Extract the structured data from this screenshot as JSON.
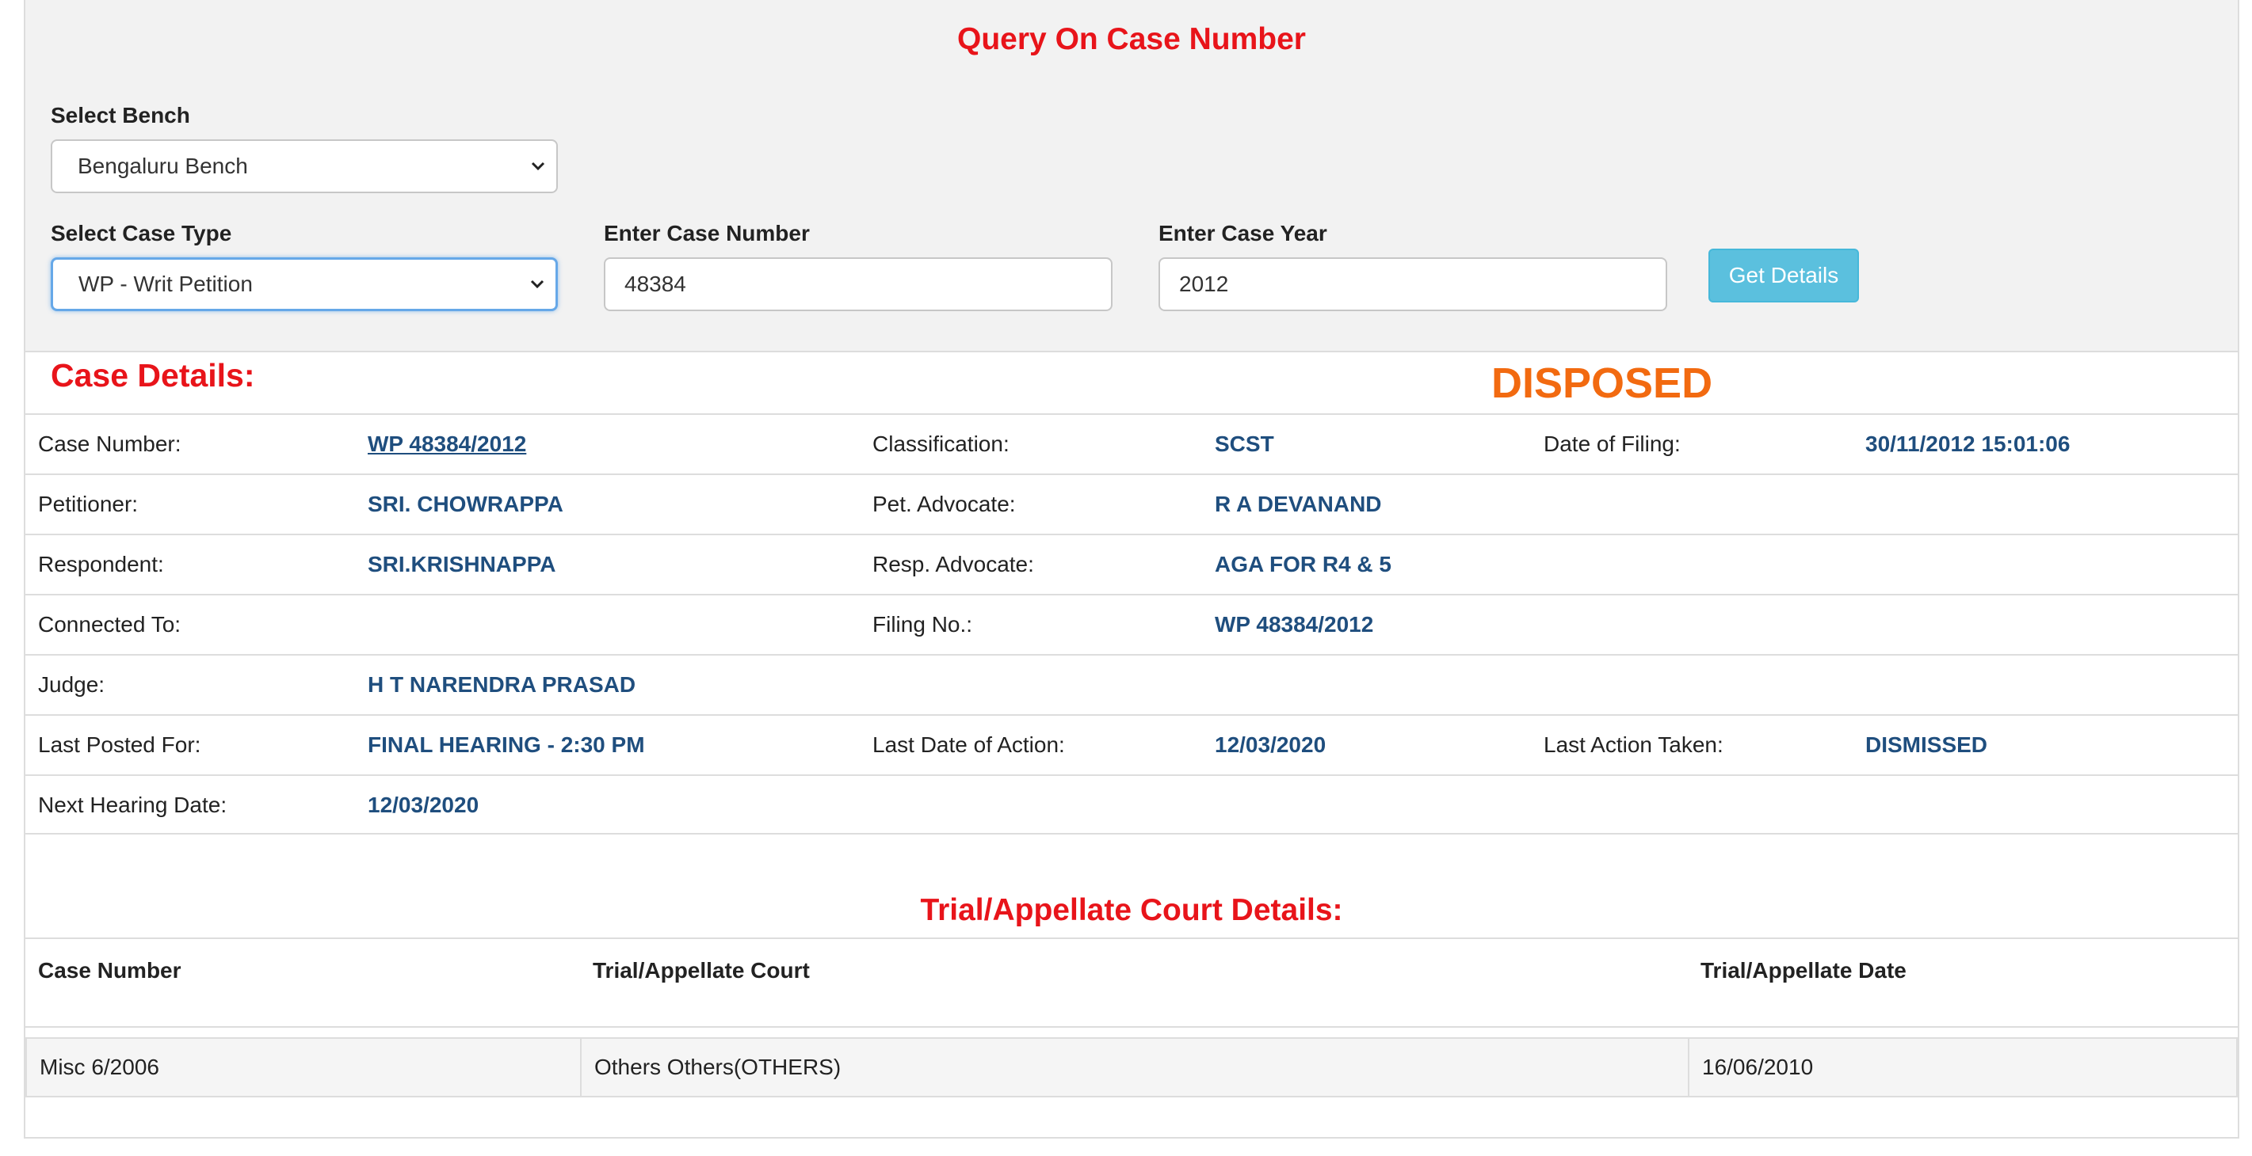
{
  "query": {
    "title": "Query On Case Number",
    "bench_label": "Select Bench",
    "bench_value": "Bengaluru Bench",
    "case_type_label": "Select Case Type",
    "case_type_value": "WP - Writ Petition",
    "case_number_label": "Enter Case Number",
    "case_number_value": "48384",
    "case_year_label": "Enter Case Year",
    "case_year_value": "2012",
    "submit_label": "Get Details"
  },
  "case": {
    "heading": "Case Details:",
    "status": "DISPOSED",
    "case_number_label": "Case Number:",
    "case_number": "WP 48384/2012",
    "classification_label": "Classification:",
    "classification": "SCST",
    "date_of_filing_label": "Date of Filing:",
    "date_of_filing": "30/11/2012 15:01:06",
    "petitioner_label": "Petitioner:",
    "petitioner": "SRI. CHOWRAPPA",
    "pet_advocate_label": "Pet. Advocate:",
    "pet_advocate": "R A DEVANAND",
    "respondent_label": "Respondent:",
    "respondent": "SRI.KRISHNAPPA",
    "resp_advocate_label": "Resp. Advocate:",
    "resp_advocate": "AGA FOR R4 & 5",
    "connected_to_label": "Connected To:",
    "filing_no_label": "Filing No.:",
    "filing_no": "WP 48384/2012",
    "judge_label": "Judge:",
    "judge": "H T NARENDRA PRASAD",
    "last_posted_label": "Last Posted For:",
    "last_posted": "FINAL HEARING - 2:30 PM",
    "last_date_label": "Last Date of Action:",
    "last_date": "12/03/2020",
    "last_action_label": "Last Action Taken:",
    "last_action": "DISMISSED",
    "next_hearing_label": "Next Hearing Date:",
    "next_hearing": "12/03/2020"
  },
  "trial": {
    "heading": "Trial/Appellate Court Details:",
    "columns": [
      "Case Number",
      "Trial/Appellate Court",
      "Trial/Appellate Date"
    ],
    "rows": [
      [
        "Misc 6/2006",
        "Others Others(OTHERS)",
        "16/06/2010"
      ]
    ]
  }
}
